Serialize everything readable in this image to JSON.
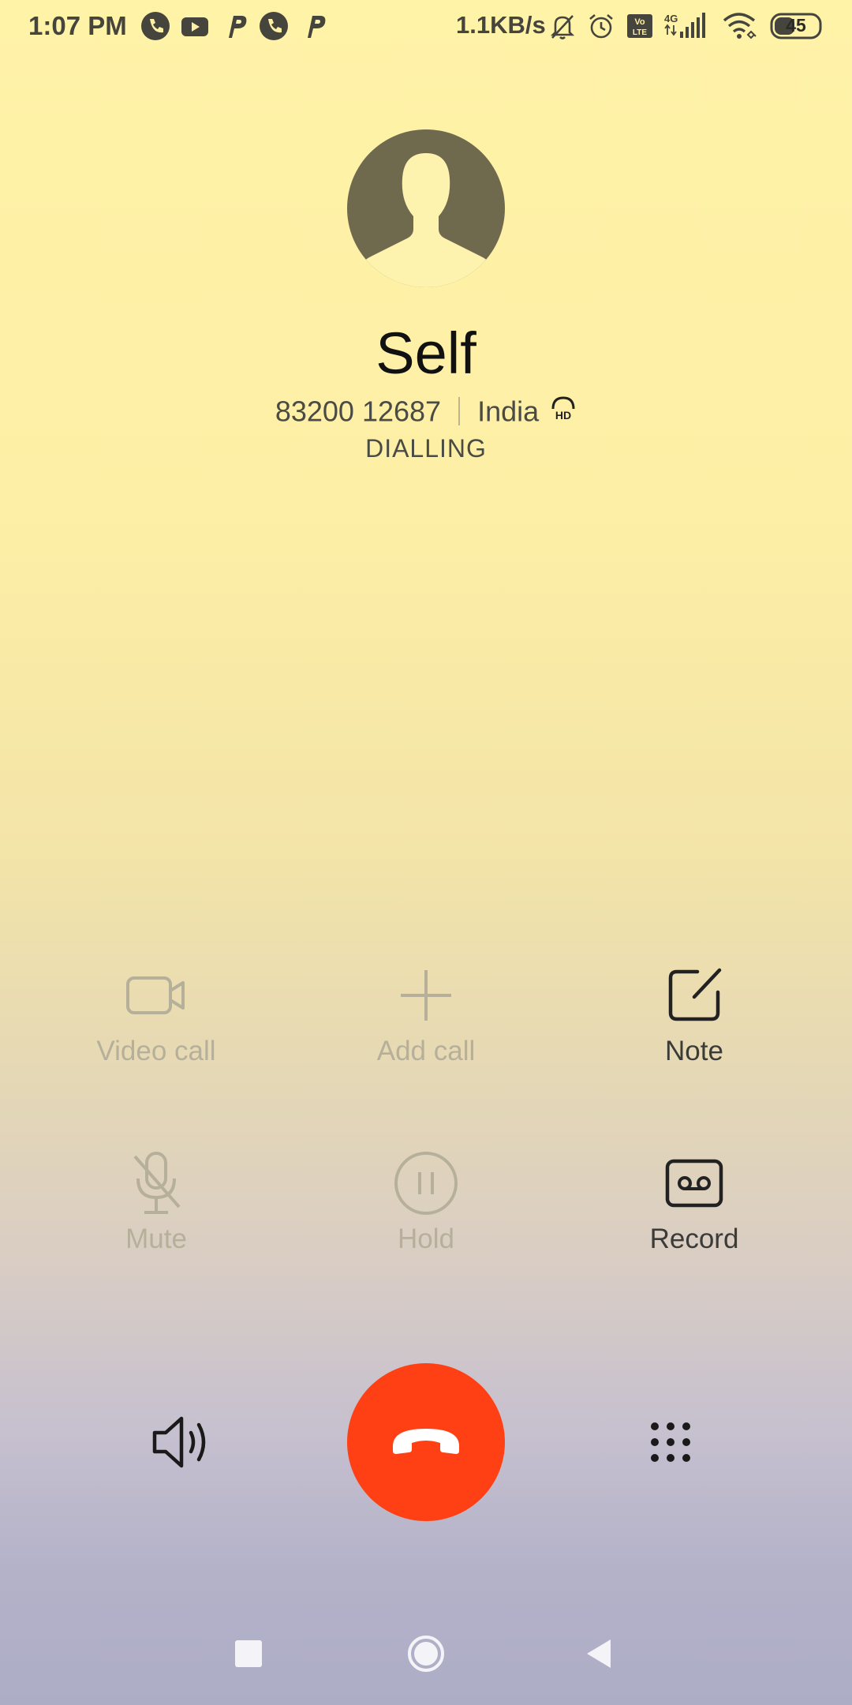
{
  "status_bar": {
    "time": "1:07 PM",
    "net_speed": "1.1KB/s",
    "network_type": "4G",
    "volte": "Vo LTE",
    "battery": "45",
    "left_icons": [
      "phone-icon",
      "youtube-icon",
      "paytm-icon",
      "phone-icon",
      "paytm-icon"
    ],
    "right_icons": [
      "bell-muted-icon",
      "alarm-icon",
      "volte-icon",
      "signal-icon",
      "wifi-icon",
      "battery-icon"
    ]
  },
  "contact": {
    "name": "Self",
    "number": "83200 12687",
    "location": "India",
    "hd": "HD",
    "status": "DIALLING"
  },
  "controls": {
    "video_call": "Video call",
    "add_call": "Add call",
    "note": "Note",
    "mute": "Mute",
    "hold": "Hold",
    "record": "Record"
  },
  "colors": {
    "end_call": "#ff4014",
    "avatar": "#6f6a4d",
    "disabled": "#b6b09a",
    "enabled": "#222222"
  }
}
